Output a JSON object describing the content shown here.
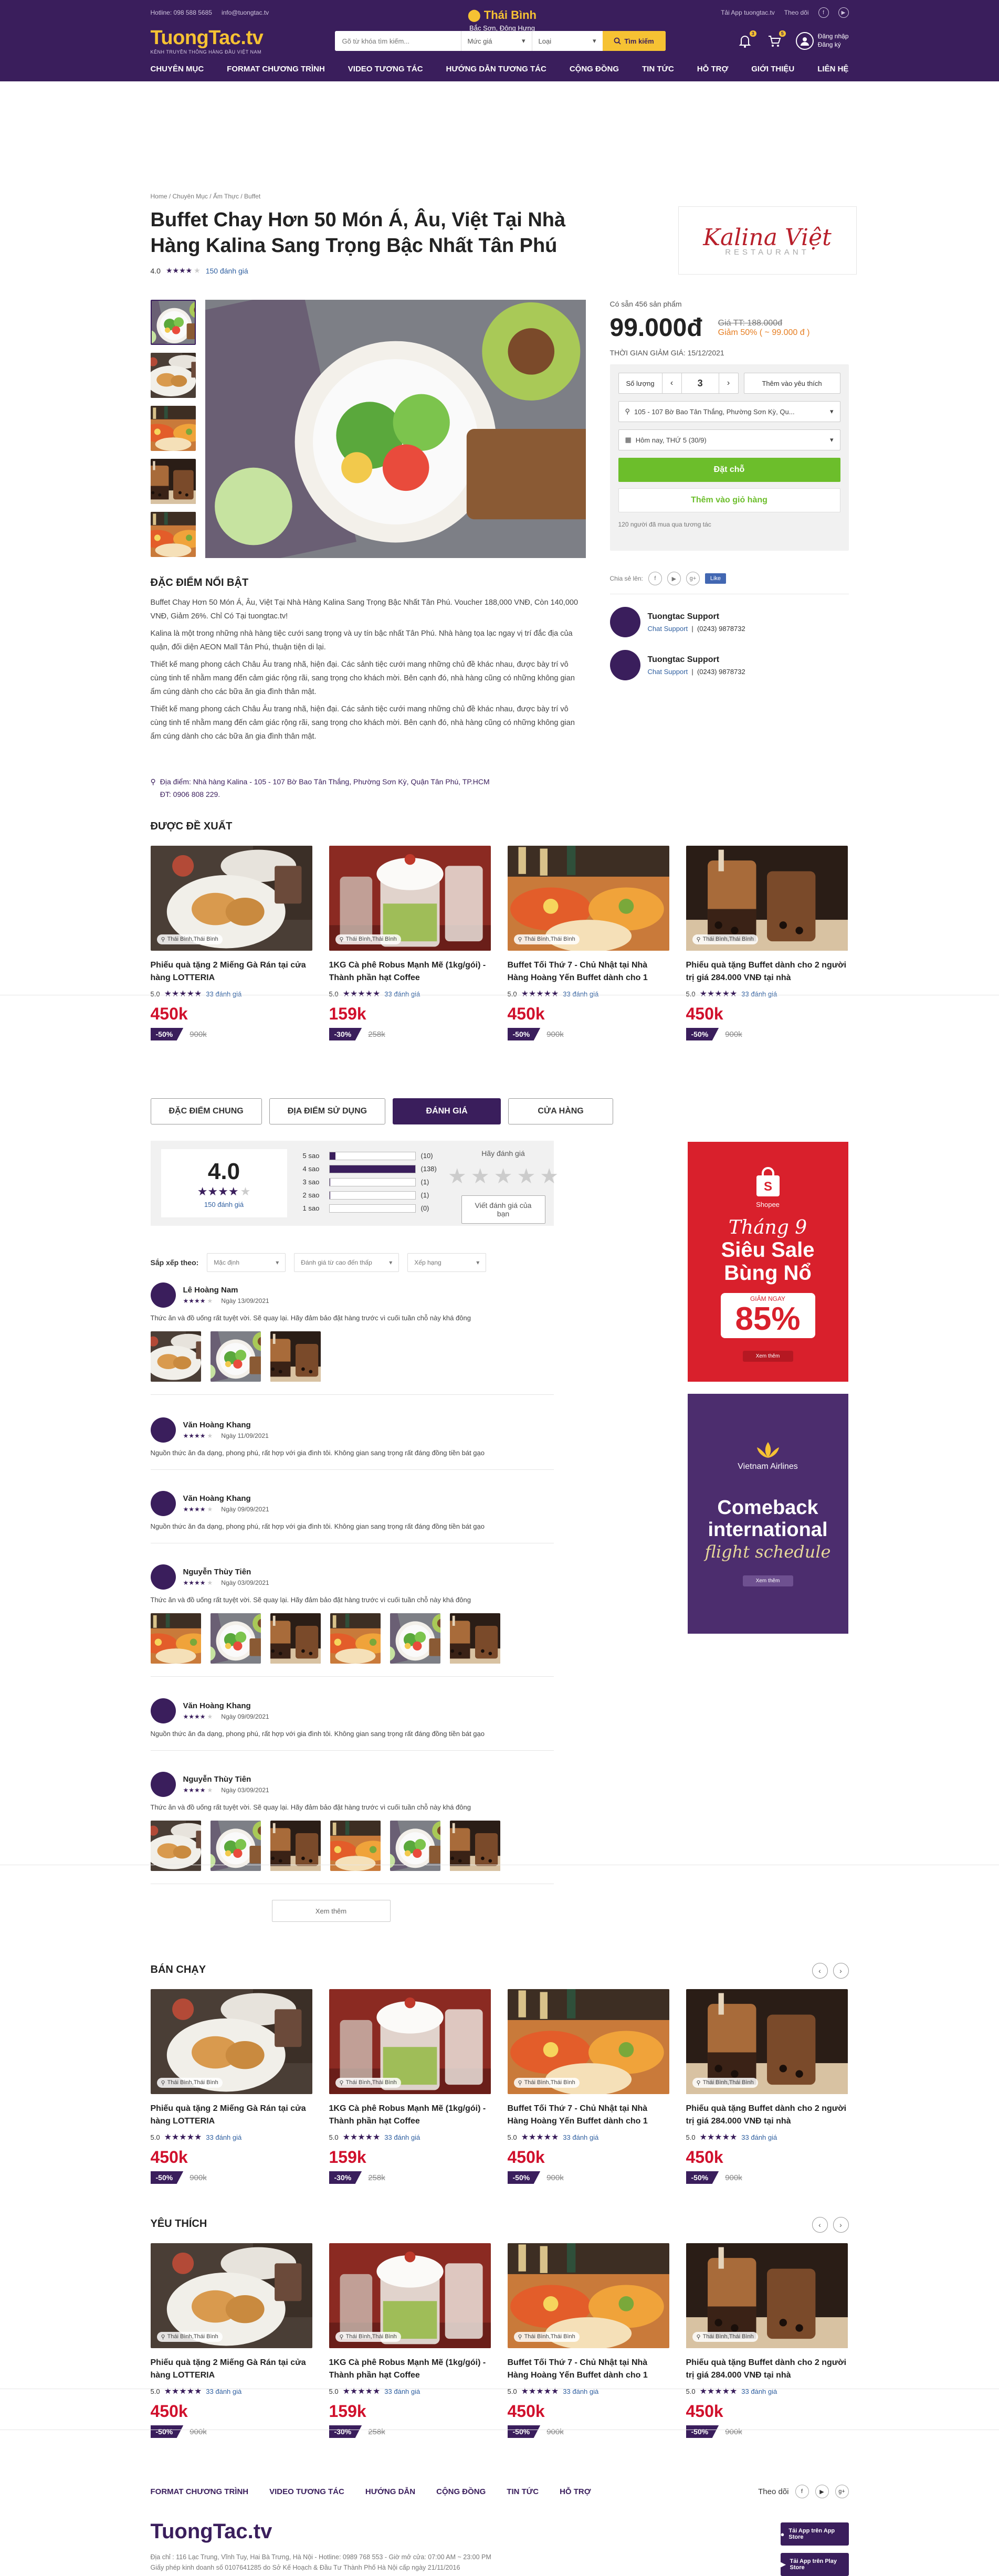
{
  "header": {
    "hotline": "Hotline: 098 588 5685",
    "email": "info@tuongtac.tv",
    "download_app": "Tải App tuongtac.tv",
    "follow": "Theo dõi",
    "logo": "TuongTac.tv",
    "logo_sub": "KÊNH TRUYỀN THÔNG HÀNG ĐẦU VIỆT NAM",
    "city": "Thái Bình",
    "city_sub": "Bắc Sơn, Đông Hưng",
    "search_placeholder": "Gõ từ khóa tìm kiếm...",
    "price_select": "Mức giá",
    "type_select": "Loại",
    "search_button": "Tìm kiếm",
    "notif_count": "3",
    "cart_count": "5",
    "login": "Đăng nhập",
    "register": "Đăng ký"
  },
  "nav": [
    "CHUYÊN MỤC",
    "FORMAT CHƯƠNG TRÌNH",
    "VIDEO TƯƠNG TÁC",
    "HƯỚNG DẪN TƯƠNG TÁC",
    "CỘNG ĐỒNG",
    "TIN TỨC",
    "HỖ TRỢ",
    "GIỚI THIỆU",
    "LIÊN HỆ"
  ],
  "breadcrumb": "Home   /   Chuyên Mục   /   Ẩm Thực   /   Buffet",
  "product": {
    "title": "Buffet Chay Hơn 50 Món Á, Âu, Việt Tại Nhà Hàng Kalina Sang Trọng Bậc Nhất Tân Phú",
    "rating": "4.0",
    "reviews": "150 đánh giá",
    "brand": "Kalina Việt",
    "brand_sub": "RESTAURANT",
    "available": "Có sẵn 456 sản phẩm",
    "price": "99.000đ",
    "old_price": "Giá TT: 188.000đ",
    "discount": "Giảm 50% ( ~ 99.000 đ )",
    "sale_date": "THỜI GIAN GIẢM GIÁ: 15/12/2021",
    "qty_label": "Số lượng",
    "qty": "3",
    "wishlist": "Thêm vào yêu thích",
    "address_select": "105 - 107 Bờ Bao Tân Thắng, Phường Sơn Kỳ, Qu...",
    "date_select": "Hôm nay, THỨ 5 (30/9)",
    "book": "Đặt chỗ",
    "add_cart": "Thêm vào giỏ hàng",
    "bought": "120 người đã mua qua tương tác",
    "share": "Chia sẻ lên:",
    "like": "Like"
  },
  "support": [
    {
      "name": "Tuongtac Support",
      "role": "Chat Support",
      "phone": "(0243) 9878732"
    },
    {
      "name": "Tuongtac Support",
      "role": "Chat Support",
      "phone": "(0243) 9878732"
    }
  ],
  "features": {
    "heading": "ĐẶC ĐIỂM NỔI BẬT",
    "paragraphs": [
      "Buffet Chay Hơn 50 Món Á, Âu, Việt Tại Nhà Hàng Kalina Sang Trọng Bậc Nhất Tân Phú. Voucher 188,000 VNĐ, Còn 140,000 VNĐ, Giảm 26%. Chỉ Có Tại tuongtac.tv!",
      "Kalina là một trong những nhà hàng tiệc cưới sang trọng và uy tín bậc nhất Tân Phú. Nhà hàng tọa lạc ngay vị trí đắc địa của quận, đối diện AEON Mall Tân Phú, thuận tiện di lại.",
      "Thiết kế mang phong cách Châu Âu trang nhã, hiện đại. Các sảnh tiệc cưới mang những chủ đề khác nhau, được bày trí vô cùng tinh tế nhằm mang đến cảm giác rộng rãi, sang trọng cho khách mời. Bên cạnh đó, nhà hàng cũng có những không gian ẩm cúng dành cho các bữa ăn gia đình thân mật.",
      "Thiết kế mang phong cách Châu Âu trang nhã, hiện đại. Các sảnh tiệc cưới mang những chủ đề khác nhau, được bày trí vô cùng tinh tế nhằm mang đến cảm giác rộng rãi, sang trọng cho khách mời. Bên cạnh đó, nhà hàng cũng có những không gian ẩm cúng dành cho các bữa ăn gia đình thân mật."
    ],
    "address_label": "Địa điểm:",
    "address": "Nhà hàng Kalina - 105 - 107 Bờ Bao Tân Thắng, Phường Sơn Kỳ, Quận Tân Phú, TP.HCM",
    "phone": "ĐT: 0906 808 229."
  },
  "sections": {
    "recommended": "ĐƯỢC ĐỀ XUẤT",
    "bestseller": "BÁN CHẠY",
    "favorite": "YÊU THÍCH"
  },
  "cards": [
    {
      "title": "Phiếu quà tặng 2 Miếng Gà Rán tại cửa hàng LOTTERIA",
      "loc": "Thái Bình,Thái Bình",
      "rating": "5.0",
      "reviews": "33 đánh giá",
      "price": "450k",
      "disc": "-50%",
      "old": "900k"
    },
    {
      "title": "1KG Cà phê Robus Mạnh Mẽ (1kg/gói) - Thành phần hạt Coffee",
      "loc": "Thái Bình,Thái Bình",
      "rating": "5.0",
      "reviews": "33 đánh giá",
      "price": "159k",
      "disc": "-30%",
      "old": "258k"
    },
    {
      "title": "Buffet Tối Thứ 7 - Chủ Nhật tại Nhà Hàng Hoàng Yến Buffet dành cho 1",
      "loc": "Thái Bình,Thái Bình",
      "rating": "5.0",
      "reviews": "33 đánh giá",
      "price": "450k",
      "disc": "-50%",
      "old": "900k"
    },
    {
      "title": "Phiếu quà tặng Buffet dành cho 2 người trị giá 284.000 VNĐ tại nhà",
      "loc": "Thái Bình,Thái Bình",
      "rating": "5.0",
      "reviews": "33 đánh giá",
      "price": "450k",
      "disc": "-50%",
      "old": "900k"
    }
  ],
  "tabs": [
    "ĐẶC ĐIỂM CHUNG",
    "ĐỊA ĐIỂM SỬ DỤNG",
    "ĐÁNH GIÁ",
    "CỬA HÀNG"
  ],
  "ratings": {
    "score": "4.0",
    "count": "150 đánh giá",
    "bars": [
      {
        "label": "5 sao",
        "count": "(10)",
        "fraction": 0.07
      },
      {
        "label": "4 sao",
        "count": "(138)",
        "fraction": 1.0
      },
      {
        "label": "3 sao",
        "count": "(1)",
        "fraction": 0.01
      },
      {
        "label": "2 sao",
        "count": "(1)",
        "fraction": 0.01
      },
      {
        "label": "1 sao",
        "count": "(0)",
        "fraction": 0
      }
    ],
    "your_rating": "Hãy đánh giá",
    "write": "Viết đánh giá của bạn"
  },
  "sort": {
    "label": "Sắp xếp theo:",
    "options": [
      "Mặc định",
      "Đánh giá từ cao đến thấp",
      "Xếp hạng"
    ]
  },
  "reviews": [
    {
      "name": "Lê Hoàng Nam",
      "date": "Ngày 13/09/2021",
      "text": "Thức ăn và đồ uống rất tuyệt vời. Sẽ quay lại. Hãy đảm bảo đặt hàng trước vì cuối tuần chỗ này khá đông"
    },
    {
      "name": "Văn Hoàng Khang",
      "date": "Ngày 11/09/2021",
      "text": "Nguồn thức ăn đa dạng, phong phú, rất hợp với gia đình tôi. Không gian sang trọng rất đáng đồng tiền bát gạo"
    },
    {
      "name": "Văn Hoàng Khang",
      "date": "Ngày 09/09/2021",
      "text": "Nguồn thức ăn đa dạng, phong phú, rất hợp với gia đình tôi. Không gian sang trọng rất đáng đồng tiền bát gạo"
    },
    {
      "name": "Nguyễn Thùy Tiên",
      "date": "Ngày 03/09/2021",
      "text": "Thức ăn và đồ uống rất tuyệt vời. Sẽ quay lại. Hãy đảm bảo đặt hàng trước vì cuối tuần chỗ này khá đông"
    },
    {
      "name": "Văn Hoàng Khang",
      "date": "Ngày 09/09/2021",
      "text": "Nguồn thức ăn đa dạng, phong phú, rất hợp với gia đình tôi. Không gian sang trọng rất đáng đồng tiền bát gạo"
    },
    {
      "name": "Nguyễn Thùy Tiên",
      "date": "Ngày 03/09/2021",
      "text": "Thức ăn và đồ uống rất tuyệt vời. Sẽ quay lại. Hãy đảm bảo đặt hàng trước vì cuối tuần chỗ này khá đông"
    }
  ],
  "see_more": "Xem thêm",
  "ads": {
    "shopee": {
      "brand": "Shopee",
      "line1": "Tháng 9",
      "line2": "Siêu Sale",
      "line3": "Bùng Nổ",
      "sub": "GIẢM NGAY",
      "pct": "85%",
      "btn": "Xem thêm"
    },
    "vna": {
      "brand": "Vietnam Airlines",
      "line1": "Comeback",
      "line2": "international",
      "line3": "flight schedule",
      "btn": "Xem thêm"
    }
  },
  "footer": {
    "nav": [
      "FORMAT CHƯƠNG TRÌNH",
      "VIDEO TƯƠNG TÁC",
      "HƯỚNG DẪN",
      "CỘNG ĐỒNG",
      "TIN TỨC",
      "HỖ TRỢ"
    ],
    "follow": "Theo dõi",
    "logo": "TuongTac.tv",
    "address": "Địa chỉ : 116 Lạc Trung, Vĩnh Tuy, Hai Bà Trưng, Hà Nội - Hotline: 0989 768 553 - Giờ mở cửa: 07:00 AM ~ 23:00 PM",
    "license": "Giấy phép kinh doanh số 0107641285 do Sở Kế Hoạch & Đầu Tư Thành Phố Hà Nội cấp ngày 21/11/2016",
    "appstore": "Tải App trên App Store",
    "playstore": "Tải App trên Play Store"
  },
  "colors": {
    "brand": "#3a1e5c",
    "accent": "#f6c233",
    "price": "#d0102c",
    "green": "#6cbe2b"
  }
}
